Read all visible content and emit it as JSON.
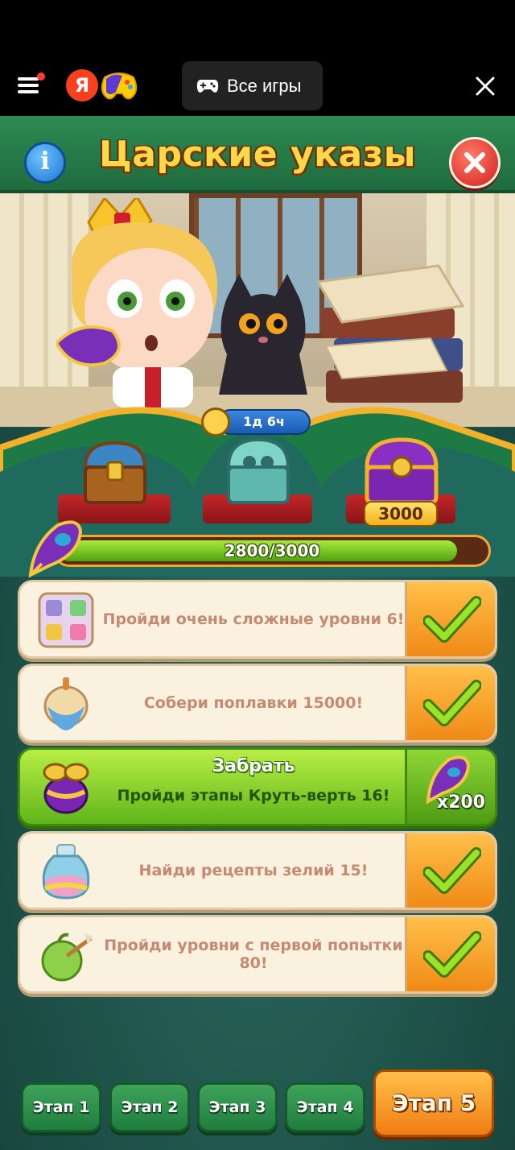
{
  "host": {
    "ya_logo": "Я",
    "all_games_label": "Все игры"
  },
  "game": {
    "title": "Царские указы",
    "info_label": "i",
    "timer": "1д 6ч",
    "chest_reward": "3000",
    "progress": {
      "text": "2800/3000",
      "current": 2800,
      "total": 3000
    },
    "tasks": [
      {
        "text": "Пройди очень сложные уровни 6!",
        "icon": "puzzle-pieces-icon",
        "state": "done"
      },
      {
        "text": "Собери поплавки 15000!",
        "icon": "float-bobber-icon",
        "state": "done"
      },
      {
        "title": "Забрать",
        "text": "Пройди этапы Круть-верть 16!",
        "icon": "spinner-toy-icon",
        "state": "claim",
        "reward": "x200"
      },
      {
        "text": "Найди рецепты зелий 15!",
        "icon": "potion-bottle-icon",
        "state": "done"
      },
      {
        "text": "Пройди уровни с первой попытки 80!",
        "icon": "apple-arrow-icon",
        "state": "done"
      }
    ],
    "stages": [
      "Этап 1",
      "Этап 2",
      "Этап 3",
      "Этап 4",
      "Этап 5"
    ],
    "active_stage": 5
  },
  "colors": {
    "title": "#ffd84a",
    "panel_green": "#1d5b50",
    "check_orange": "#f08a16",
    "claim_green": "#61b51a",
    "task_text": "#c58a72"
  }
}
